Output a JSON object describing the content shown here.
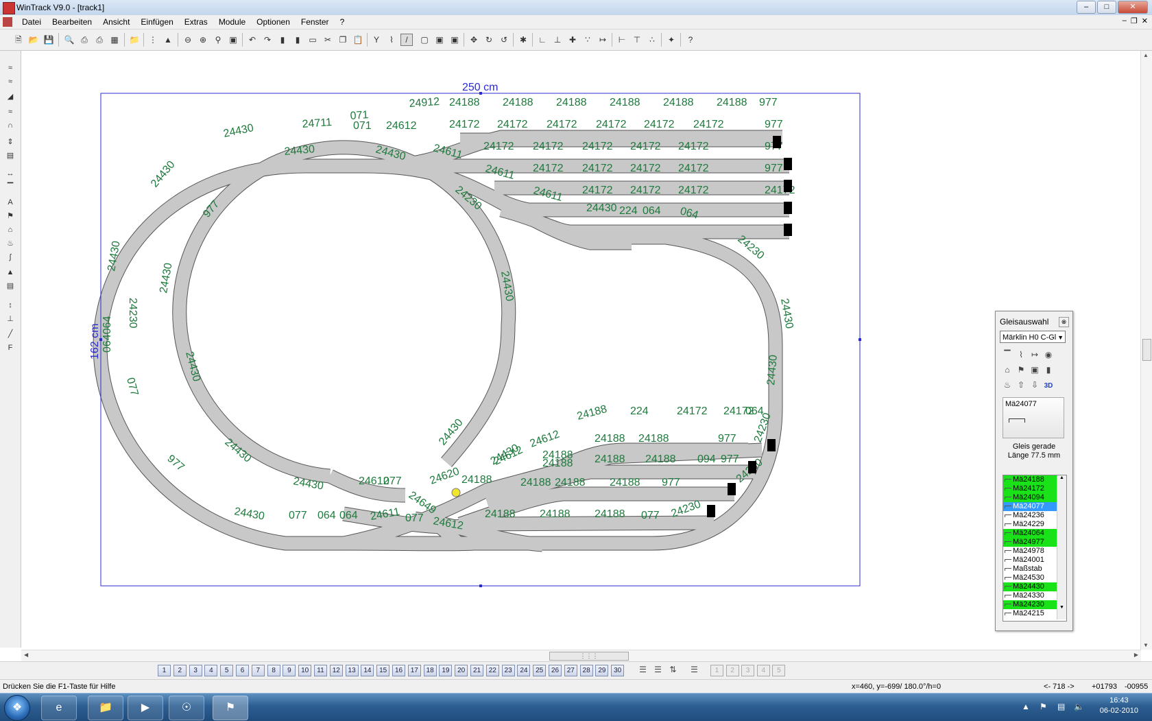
{
  "window": {
    "title": "WinTrack  V9.0 - [track1]"
  },
  "menu": {
    "items": [
      "Datei",
      "Bearbeiten",
      "Ansicht",
      "Einfügen",
      "Extras",
      "Module",
      "Optionen",
      "Fenster",
      "?"
    ]
  },
  "canvas": {
    "width_label": "250 cm",
    "height_label": "162 cm",
    "track_labels": [
      "24912",
      "24188",
      "24188",
      "24188",
      "24188",
      "24188",
      "24188",
      "977",
      "24711",
      "071",
      "071",
      "24612",
      "24172",
      "24172",
      "24172",
      "24172",
      "24172",
      "24172",
      "977",
      "24430",
      "24611",
      "24172",
      "24172",
      "24172",
      "24172",
      "24172",
      "977",
      "24430",
      "24430",
      "24611",
      "24172",
      "24172",
      "24172",
      "24172",
      "977",
      "24430",
      "24611",
      "24172",
      "24172",
      "24172",
      "24172",
      "977",
      "24430",
      "224",
      "064",
      "064",
      "24230",
      "24430",
      "24430",
      "24230",
      "24430",
      "24430",
      "24230",
      "064064",
      "077",
      "24430",
      "24430",
      "24188",
      "224",
      "24172",
      "24172",
      "064",
      "977",
      "24430",
      "24430",
      "24612",
      "24188",
      "24188",
      "24188",
      "977",
      "24230",
      "24430",
      "24612",
      "24188",
      "24188",
      "24188",
      "094",
      "977",
      "24430",
      "24612",
      "077",
      "24620",
      "24188",
      "24188",
      "24188",
      "24188",
      "977",
      "24230",
      "24430",
      "077",
      "064",
      "064",
      "24611",
      "077",
      "24649",
      "24612",
      "24188",
      "24188",
      "24188",
      "077",
      "24230"
    ]
  },
  "gleisauswahl": {
    "title": "Gleisauswahl",
    "system": "Märklin H0 C-Gl",
    "selected_article": "Mä24077",
    "desc1": "Gleis gerade",
    "desc2": "Länge 77.5 mm",
    "articles": [
      {
        "name": "Mä24188",
        "state": "used"
      },
      {
        "name": "Mä24172",
        "state": "used"
      },
      {
        "name": "Mä24094",
        "state": "used"
      },
      {
        "name": "Mä24077",
        "state": "selected"
      },
      {
        "name": "Mä24236",
        "state": "normal"
      },
      {
        "name": "Mä24229",
        "state": "normal"
      },
      {
        "name": "Mä24064",
        "state": "used"
      },
      {
        "name": "Mä24977",
        "state": "used"
      },
      {
        "name": "Mä24978",
        "state": "normal"
      },
      {
        "name": "Mä24001",
        "state": "normal"
      },
      {
        "name": "Maßstab",
        "state": "normal"
      },
      {
        "name": "Mä24530",
        "state": "normal"
      },
      {
        "name": "Mä24430",
        "state": "used"
      },
      {
        "name": "Mä24330",
        "state": "normal"
      },
      {
        "name": "Mä24230",
        "state": "used"
      },
      {
        "name": "Mä24215",
        "state": "normal"
      }
    ]
  },
  "layers": [
    "1",
    "2",
    "3",
    "4",
    "5",
    "6",
    "7",
    "8",
    "9",
    "10",
    "11",
    "12",
    "13",
    "14",
    "15",
    "16",
    "17",
    "18",
    "19",
    "20",
    "21",
    "22",
    "23",
    "24",
    "25",
    "26",
    "27",
    "28",
    "29",
    "30"
  ],
  "module_layers": [
    "1",
    "2",
    "3",
    "4",
    "5"
  ],
  "status": {
    "help": "Drücken Sie die  F1-Taste für Hilfe",
    "coords": "x=460, y=-699/ 180.0°/h=0",
    "length": "<- 718 ->",
    "pos_x": "+01793",
    "pos_y": "-00955"
  },
  "taskbar": {
    "time": "16:43",
    "date": "06-02-2010"
  },
  "colors": {
    "track_fill": "#c8c8c8",
    "label_green": "#1e7a3c",
    "frame_blue": "#2a2ad0",
    "list_green": "#19e219",
    "list_selected": "#3399ff"
  }
}
